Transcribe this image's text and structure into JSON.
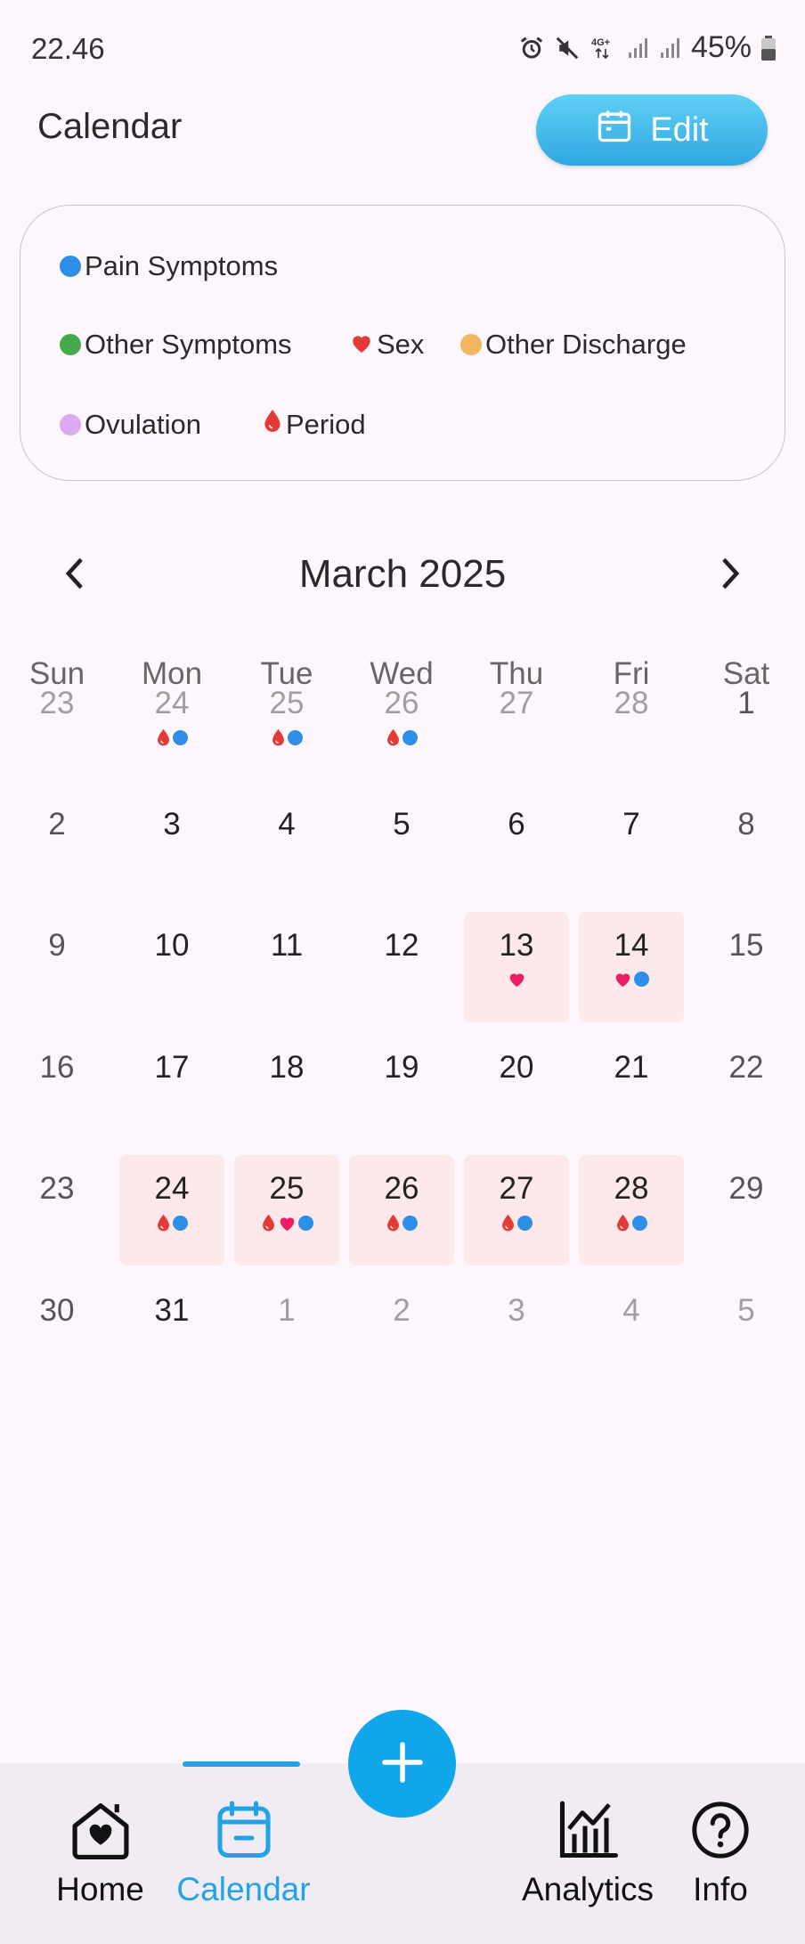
{
  "status_bar": {
    "time": "22.46",
    "battery": "45%"
  },
  "header": {
    "title": "Calendar",
    "edit_label": "Edit"
  },
  "legend": [
    {
      "label": "Pain Symptoms",
      "color": "#2d8fe7",
      "icon": "dot"
    },
    {
      "label": "Other Symptoms",
      "color": "#46a94b",
      "icon": "dot"
    },
    {
      "label": "Sex",
      "color": "#e53935",
      "icon": "heart"
    },
    {
      "label": "Other Discharge",
      "color": "#f2b661",
      "icon": "dot"
    },
    {
      "label": "Ovulation",
      "color": "#dcaaf0",
      "icon": "dot"
    },
    {
      "label": "Period",
      "color": "#e53935",
      "icon": "drop"
    }
  ],
  "calendar": {
    "month_label": "March 2025",
    "weekdays": [
      "Sun",
      "Mon",
      "Tue",
      "Wed",
      "Thu",
      "Fri",
      "Sat"
    ],
    "weeks": [
      [
        {
          "day": "23",
          "other": true
        },
        {
          "day": "24",
          "other": true,
          "marks": [
            "period",
            "pain"
          ]
        },
        {
          "day": "25",
          "other": true,
          "marks": [
            "period",
            "pain"
          ]
        },
        {
          "day": "26",
          "other": true,
          "marks": [
            "period",
            "pain"
          ]
        },
        {
          "day": "27",
          "other": true
        },
        {
          "day": "28",
          "other": true
        },
        {
          "day": "1"
        }
      ],
      [
        {
          "day": "2"
        },
        {
          "day": "3"
        },
        {
          "day": "4"
        },
        {
          "day": "5"
        },
        {
          "day": "6"
        },
        {
          "day": "7"
        },
        {
          "day": "8"
        }
      ],
      [
        {
          "day": "9"
        },
        {
          "day": "10"
        },
        {
          "day": "11"
        },
        {
          "day": "12"
        },
        {
          "day": "13",
          "highlight": true,
          "marks": [
            "sex"
          ]
        },
        {
          "day": "14",
          "highlight": true,
          "marks": [
            "sex",
            "pain"
          ]
        },
        {
          "day": "15"
        }
      ],
      [
        {
          "day": "16"
        },
        {
          "day": "17"
        },
        {
          "day": "18"
        },
        {
          "day": "19"
        },
        {
          "day": "20"
        },
        {
          "day": "21"
        },
        {
          "day": "22"
        }
      ],
      [
        {
          "day": "23"
        },
        {
          "day": "24",
          "highlight": true,
          "marks": [
            "period",
            "pain"
          ]
        },
        {
          "day": "25",
          "highlight": true,
          "marks": [
            "period",
            "sex",
            "pain"
          ]
        },
        {
          "day": "26",
          "highlight": true,
          "marks": [
            "period",
            "pain"
          ]
        },
        {
          "day": "27",
          "highlight": true,
          "marks": [
            "period",
            "pain"
          ]
        },
        {
          "day": "28",
          "highlight": true,
          "marks": [
            "period",
            "pain"
          ]
        },
        {
          "day": "29"
        }
      ],
      [
        {
          "day": "30"
        },
        {
          "day": "31"
        },
        {
          "day": "1",
          "other": true
        },
        {
          "day": "2",
          "other": true
        },
        {
          "day": "3",
          "other": true
        },
        {
          "day": "4",
          "other": true
        },
        {
          "day": "5",
          "other": true
        }
      ]
    ]
  },
  "colors": {
    "accent": "#22a3e8",
    "highlight_bg": "#fde8ea",
    "period": "#e53935",
    "sex": "#e91e63",
    "pain": "#2d8fe7"
  },
  "bottom_nav": {
    "items": [
      {
        "label": "Home",
        "icon": "home-heart-icon"
      },
      {
        "label": "Calendar",
        "icon": "calendar-icon",
        "active": true
      },
      {
        "label": "Analytics",
        "icon": "analytics-icon"
      },
      {
        "label": "Info",
        "icon": "info-icon"
      }
    ],
    "fab_icon": "plus-icon"
  }
}
